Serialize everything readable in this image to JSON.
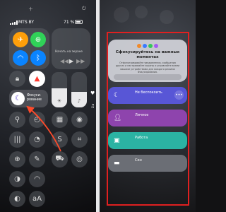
{
  "status_bar": {
    "carrier": "MTS BY",
    "battery": "71 %"
  },
  "icons": {
    "airplane": "airplane-icon",
    "cellular": "cellular-icon",
    "wifi": "wifi-icon",
    "bluetooth": "bluetooth-icon",
    "airdrop": "airdrop-icon",
    "hotspot": "hotspot-icon"
  },
  "media": {
    "title": "Начать на экране"
  },
  "focus_tile": {
    "label_line1": "Фокуси-",
    "label_line2": "рование"
  },
  "focus_card": {
    "heading": "Сфокусируйтесь на важных моментах",
    "description": "Отфильтровывайте уведомления, сообщения других и настраивайте экраны и управляйте всеми вашими устройствами для каждого режима Фокусирования.",
    "dot_colors": [
      "#f08a2a",
      "#3a7bff",
      "#34c759",
      "#a25cf2"
    ]
  },
  "modes": [
    {
      "title": "Не беспокоить",
      "subtitle": "",
      "icon": "moon-icon",
      "color": "#5856d6",
      "more": "•••"
    },
    {
      "title": "Личное",
      "subtitle": "",
      "icon": "person-icon",
      "color": "#8e44ad",
      "more": ""
    },
    {
      "title": "Работа",
      "subtitle": "",
      "icon": "badge-icon",
      "color": "#2bb3a3",
      "more": ""
    },
    {
      "title": "Сон",
      "subtitle": "",
      "icon": "bed-icon",
      "color": "#6b6e75",
      "more": ""
    }
  ],
  "colors": {
    "highlight": "#e02020",
    "accent_red": "#ff3b30",
    "focus_purple": "#5a3fd1"
  }
}
